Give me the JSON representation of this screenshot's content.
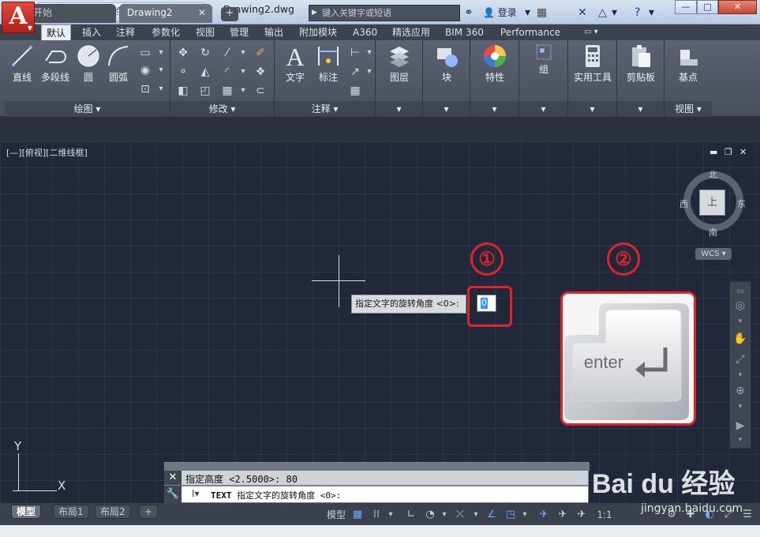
{
  "title_bar": {
    "app_menu_glyph": "A",
    "document_title": "Drawing2.dwg",
    "search_placeholder": "键入关键字或短语",
    "login_label": "登录",
    "window_controls": [
      "—",
      "□",
      "✕"
    ]
  },
  "ribbon_tabs": [
    "默认",
    "插入",
    "注释",
    "参数化",
    "视图",
    "管理",
    "输出",
    "附加模块",
    "A360",
    "精选应用",
    "BIM 360",
    "Performance"
  ],
  "ribbon": {
    "draw_panel": {
      "label": "绘图 ▾",
      "buttons": [
        "直线",
        "多段线",
        "圆",
        "圆弧"
      ]
    },
    "modify_panel": {
      "label": "修改 ▾"
    },
    "annotation_panel": {
      "label": "注释 ▾",
      "buttons": [
        "文字",
        "标注"
      ]
    },
    "layers_button": "图层",
    "block_button": "块",
    "properties_button": "特性",
    "group_button": "组",
    "utilities_button": "实用工具",
    "clipboard_button": "剪贴板",
    "base_button": "基点",
    "view_panel_label": "视图 ▾"
  },
  "doc_tabs": {
    "start": "开始",
    "drawing": "Drawing2",
    "add": "+"
  },
  "viewport": {
    "label": "[—][俯视][二维线框]",
    "compass": {
      "north": "北",
      "south": "南",
      "east": "东",
      "west": "西",
      "top": "上"
    },
    "wcs": "WCS ▾"
  },
  "prompt": {
    "tooltip_text": "指定文字的旋转角度 <0>:",
    "input_value": "0"
  },
  "annotations": {
    "step1": "①",
    "step2": "②",
    "enter_key_text": "enter"
  },
  "ucs": {
    "x": "X",
    "y": "Y"
  },
  "command": {
    "history": "指定高度 <2.5000>: 80",
    "command_name": "TEXT",
    "current_prompt": "指定文字的旋转角度 <0>:"
  },
  "layout_tabs": [
    "模型",
    "布局1",
    "布局2",
    "+"
  ],
  "statusbar": {
    "model_label": "模型",
    "scale": "1:1"
  },
  "watermark": {
    "brand": "Bai du 经验",
    "url": "jingyan.baidu.com"
  },
  "colors": {
    "accent_red": "#e0232a",
    "canvas": "#21283a"
  }
}
